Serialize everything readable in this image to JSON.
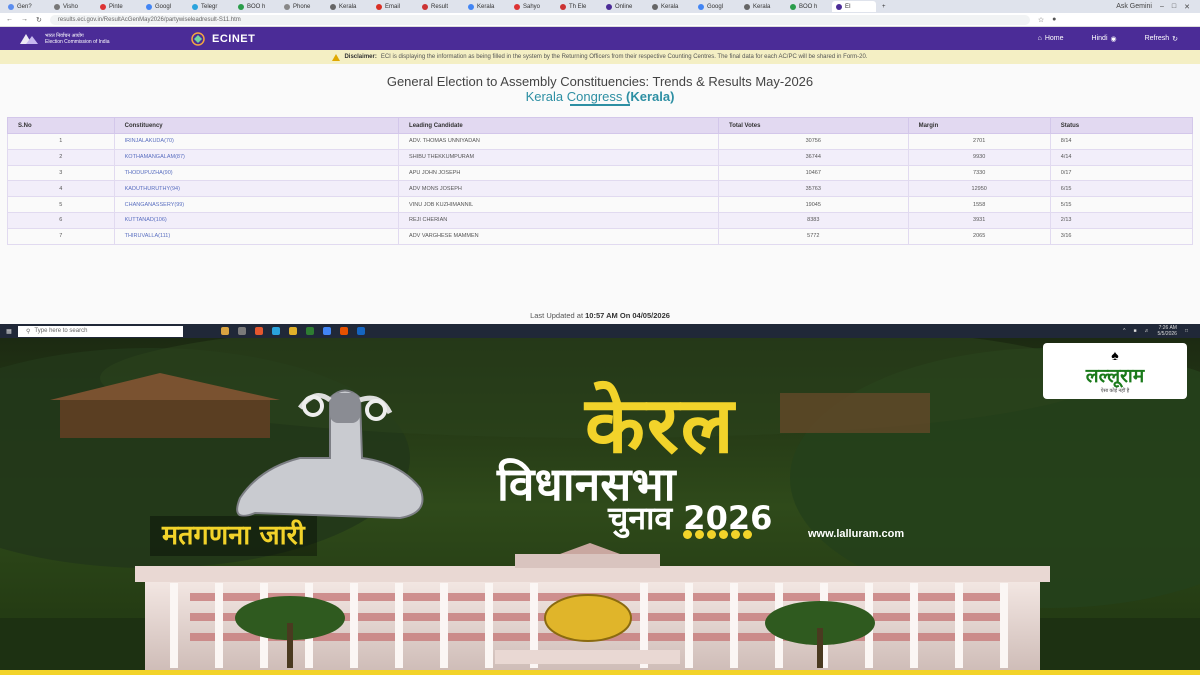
{
  "browser": {
    "tabs": [
      {
        "label": "Gen?",
        "color": "#5b8def"
      },
      {
        "label": "Visho",
        "color": "#777"
      },
      {
        "label": "Pinte",
        "color": "#d33"
      },
      {
        "label": "Googl",
        "color": "#4285f4"
      },
      {
        "label": "Telegr",
        "color": "#2aa3dc"
      },
      {
        "label": "BOO h",
        "color": "#2a9d4a"
      },
      {
        "label": "Phone",
        "color": "#888"
      },
      {
        "label": "Kerala",
        "color": "#666"
      },
      {
        "label": "Email",
        "color": "#d93025"
      },
      {
        "label": "Result",
        "color": "#c33"
      },
      {
        "label": "Kerala",
        "color": "#4285f4"
      },
      {
        "label": "Sahyo",
        "color": "#d33"
      },
      {
        "label": "Th Ele",
        "color": "#c33"
      },
      {
        "label": "Online",
        "color": "#4b2c97"
      },
      {
        "label": "Kerala",
        "color": "#666"
      },
      {
        "label": "Googl",
        "color": "#4285f4"
      },
      {
        "label": "Kerala",
        "color": "#666"
      },
      {
        "label": "BOO h",
        "color": "#2a9d4a"
      },
      {
        "label": "EI",
        "color": "#4b2c97",
        "active": true
      }
    ],
    "ask_button": "Ask Gemini",
    "url": "results.eci.gov.in/ResultAcGenMay2026/partywiseleadresult-S11.htm"
  },
  "header": {
    "eci_line1": "भारत निर्वाचन आयोग",
    "eci_line2": "Election Commission of India",
    "brand": "ECINET",
    "nav": [
      "Home",
      "Hindi",
      "Refresh"
    ]
  },
  "disclaimer": {
    "label": "Disclaimer:",
    "text": "ECI is displaying the information as being filled in the system by the Returning Officers from their respective Counting Centres. The final data for each AC/PC will be shared in Form-20."
  },
  "page": {
    "title": "General Election to Assembly Constituencies: Trends & Results May-2026",
    "party": "Kerala Congress",
    "state": "(Kerala)",
    "columns": [
      "S.No",
      "Constituency",
      "Leading Candidate",
      "Total Votes",
      "Margin",
      "Status"
    ],
    "rows": [
      [
        "1",
        "IRINJALAKUDA(70)",
        "ADV. THOMAS UNNIYADAN",
        "30756",
        "2701",
        "8/14"
      ],
      [
        "2",
        "KOTHAMANGALAM(87)",
        "SHIBU THEKKUMPURAM",
        "36744",
        "9930",
        "4/14"
      ],
      [
        "3",
        "THODUPUZHA(90)",
        "APU JOHN JOSEPH",
        "10467",
        "7330",
        "0/17"
      ],
      [
        "4",
        "KADUTHURUTHY(94)",
        "ADV MONS JOSEPH",
        "35763",
        "12950",
        "6/15"
      ],
      [
        "5",
        "CHANGANASSERY(99)",
        "VINU JOB KUZHIMANNIL",
        "19045",
        "1558",
        "5/15"
      ],
      [
        "6",
        "KUTTANAD(106)",
        "REJI CHERIAN",
        "8383",
        "3931",
        "2/13"
      ],
      [
        "7",
        "THIRUVALLA(111)",
        "ADV VARGHESE MAMMEN",
        "5772",
        "2065",
        "3/16"
      ]
    ],
    "last_updated_prefix": "Last Updated at",
    "last_updated": "10:57 AM On 04/05/2026"
  },
  "taskbar": {
    "search_placeholder": "Type here to search",
    "time": "7:26 AM",
    "date": "5/5/2026"
  },
  "poster": {
    "brand": "लल्लूराम",
    "brand_tag": "ऐसा कोई नहीं है",
    "line1": "केरल",
    "line2": "विधानसभा",
    "line3": "चुनाव 2026",
    "badge": "मतगणना जारी",
    "website": "www.lalluram.com"
  }
}
